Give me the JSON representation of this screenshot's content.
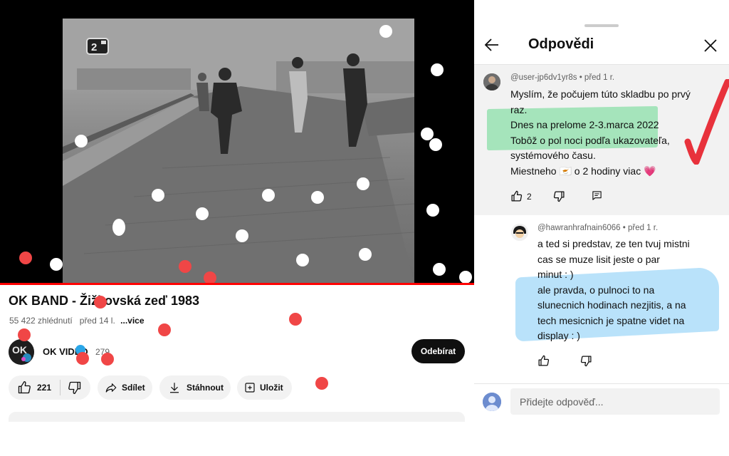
{
  "video": {
    "title": "OK BAND - Žižkovská zeď 1983",
    "views": "55 422 zhlédnutí",
    "age": "před 14 l.",
    "more_label": "...vice",
    "channel_logo_icon": "ok-video-logo-icon",
    "tv_logo_icon": "ct2-logo-icon",
    "progress_color": "#ff0000"
  },
  "channel": {
    "name": "OK VIDEO",
    "subscribers": "279",
    "subscribe_label": "Odebírat"
  },
  "actions": {
    "like_count": "221",
    "share_label": "Sdílet",
    "download_label": "Stáhnout",
    "save_label": "Uložit"
  },
  "replies_panel": {
    "title": "Odpovědi",
    "back_icon": "back-arrow-icon",
    "close_icon": "close-icon",
    "parent": {
      "author": "@user-jp6dv1yr8s",
      "time": "před 1 r.",
      "lines": [
        "Myslím, že počujem túto skladbu po prvý",
        "raz.",
        "Dnes na prelome 2-3.marca 2022",
        "Tobôž o pol noci podľa ukazovateľa,",
        "systémového času.",
        "Miestneho 🇨🇾 o 2 hodiny viac 💗"
      ],
      "like_count": "2",
      "highlight_color": "#46d278",
      "check_color": "#e8323c"
    },
    "reply": {
      "author": "@hawranhrafnain6066",
      "time": "před 1 r.",
      "lines": [
        "a ted si predstav, ze ten tvuj mistni",
        "cas se muze lisit jeste o par",
        "minut : )",
        "ale pravda, o pulnoci to na",
        "slunecnich hodinach nezjitis, a na",
        "tech mesicnich je spatne videt na",
        "display : )"
      ],
      "highlight_color": "#64bef5"
    },
    "input_placeholder": "Přidejte odpověď..."
  },
  "overlay_colors": {
    "white_dots": "#ffffff",
    "red_dots": "#f04646",
    "blue_dots": "#2aa6e8"
  }
}
